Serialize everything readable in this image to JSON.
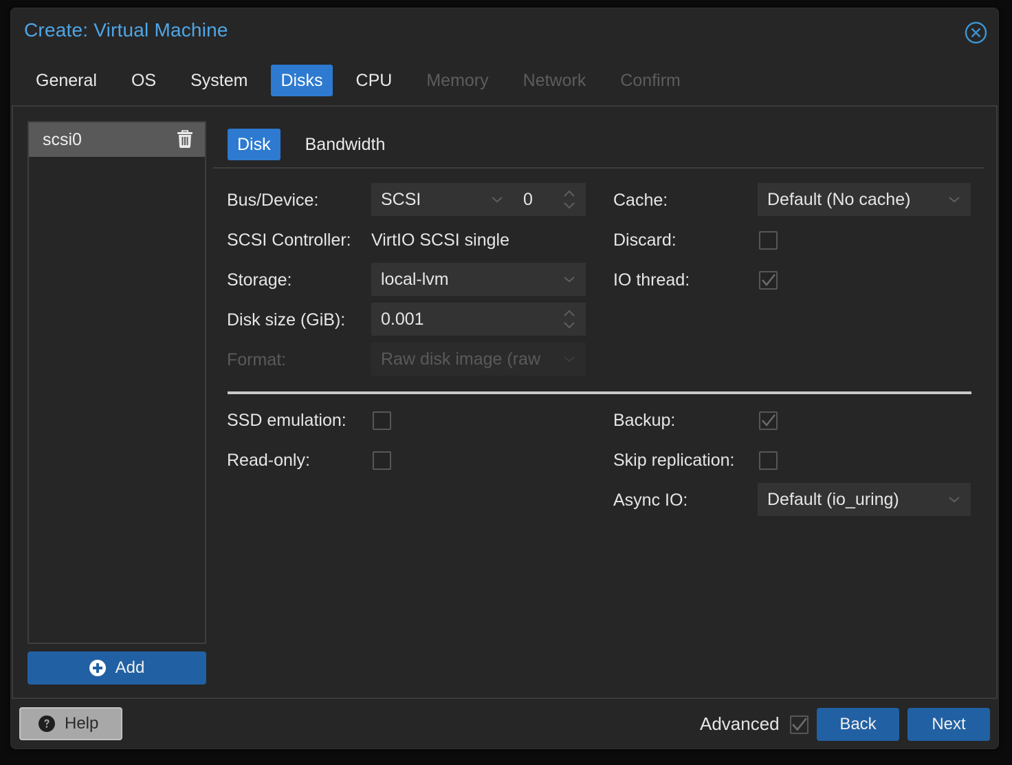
{
  "window": {
    "title": "Create: Virtual Machine",
    "close_icon": "close-circle-icon"
  },
  "tabs": [
    {
      "label": "General",
      "state": "enabled"
    },
    {
      "label": "OS",
      "state": "enabled"
    },
    {
      "label": "System",
      "state": "enabled"
    },
    {
      "label": "Disks",
      "state": "active"
    },
    {
      "label": "CPU",
      "state": "enabled"
    },
    {
      "label": "Memory",
      "state": "disabled"
    },
    {
      "label": "Network",
      "state": "disabled"
    },
    {
      "label": "Confirm",
      "state": "disabled"
    }
  ],
  "disk_list": {
    "items": [
      {
        "label": "scsi0",
        "selected": true
      }
    ],
    "delete_icon": "trash-icon",
    "add_label": "Add",
    "add_icon": "plus-circle-icon"
  },
  "subtabs": [
    {
      "label": "Disk",
      "active": true
    },
    {
      "label": "Bandwidth",
      "active": false
    }
  ],
  "form": {
    "bus_device": {
      "label": "Bus/Device:",
      "bus": "SCSI",
      "device": "0"
    },
    "scsi_controller": {
      "label": "SCSI Controller:",
      "value": "VirtIO SCSI single"
    },
    "storage": {
      "label": "Storage:",
      "value": "local-lvm"
    },
    "disk_size": {
      "label": "Disk size (GiB):",
      "value": "0.001"
    },
    "format": {
      "label": "Format:",
      "value": "Raw disk image (raw",
      "disabled": true
    },
    "cache": {
      "label": "Cache:",
      "value": "Default (No cache)"
    },
    "discard": {
      "label": "Discard:",
      "checked": false
    },
    "io_thread": {
      "label": "IO thread:",
      "checked": true
    },
    "ssd_emulation": {
      "label": "SSD emulation:",
      "checked": false
    },
    "read_only": {
      "label": "Read-only:",
      "checked": false
    },
    "backup": {
      "label": "Backup:",
      "checked": true
    },
    "skip_replication": {
      "label": "Skip replication:",
      "checked": false
    },
    "async_io": {
      "label": "Async IO:",
      "value": "Default (io_uring)"
    }
  },
  "footer": {
    "help_label": "Help",
    "help_icon": "question-circle-icon",
    "advanced_label": "Advanced",
    "advanced_checked": true,
    "back_label": "Back",
    "next_label": "Next"
  },
  "colors": {
    "accent": "#2d7ad0",
    "button_blue": "#2161a3",
    "title_blue": "#4fa6e6",
    "background": "#262626"
  }
}
